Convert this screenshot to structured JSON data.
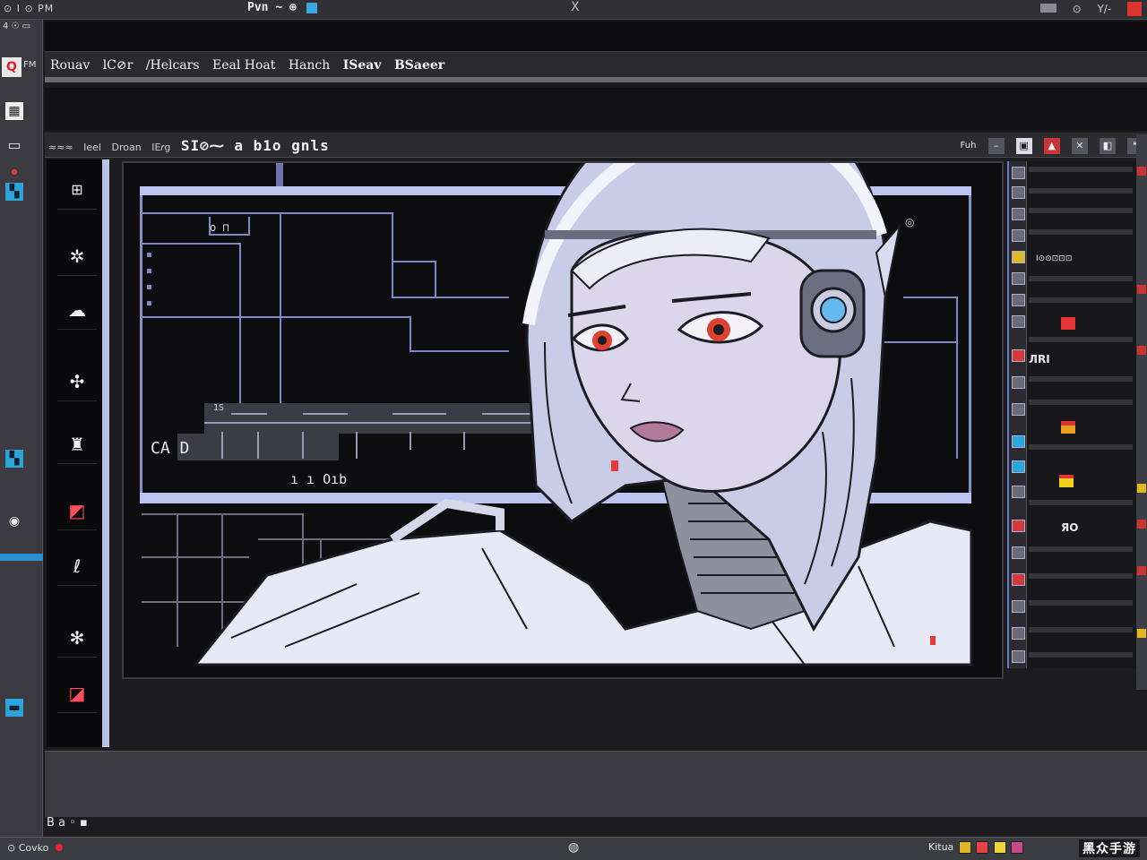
{
  "titlebar": {
    "left_glyphs": "⊙ I ⊙ PM",
    "app_name": "Pvn",
    "app_suffix": "~ ⊕",
    "center_glyph": "X",
    "right_items": [
      "Y/-"
    ]
  },
  "leftstrip": {
    "top_glyphs": "4 ☉ ▭",
    "icons": [
      "image-icon",
      "monitor-icon",
      "cyan-layer-icon",
      "globe-icon",
      "cyan-layer-icon"
    ]
  },
  "menubar": {
    "logo_glyph": "Q",
    "tag": "FM",
    "items": [
      "Rouav",
      "lC⊘r",
      "/Helcars",
      "Eeal Hoat",
      "Hanch",
      "ISeav",
      "BSaeer"
    ]
  },
  "document": {
    "labels": [
      "≈≈≈",
      "Ieel",
      "Droan",
      "IE𝑟g"
    ],
    "title": "SI⊘⁓ a b1o gnls",
    "right_label": "Fuh"
  },
  "tools": [
    "crop-icon",
    "spray-icon",
    "bird-icon",
    "move-icon",
    "stamp-icon",
    "red-eraser-icon",
    "lasso-icon",
    "gear-icon",
    "red-fill-icon"
  ],
  "canvas": {
    "text_a": "CA D",
    "text_b": "ı ı Oıb",
    "text_c": "o ⊓",
    "text_d": "1S",
    "text_e": "◎"
  },
  "right_panel": {
    "label_1": "Ⅰ⊙⊙⊡⊡⊡",
    "label_2": "ЛRI",
    "label_3": "ЯO"
  },
  "lower": {
    "dots": "B a ◦ ▪"
  },
  "statusbar": {
    "left": "Covko",
    "center": "◍",
    "right_label": "Kitua",
    "watermark": "黑众手游"
  },
  "colors": {
    "accent_lavender": "#b9c5e8",
    "accent_red": "#e43a3a",
    "accent_cyan": "#2fa4d8"
  }
}
